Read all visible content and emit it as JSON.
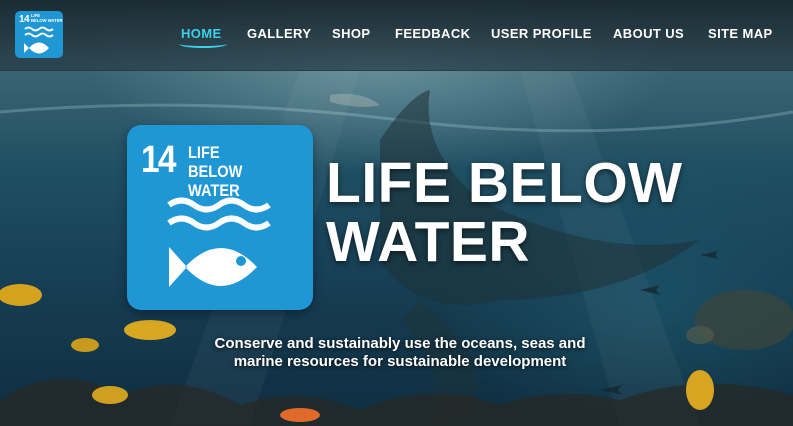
{
  "brand": {
    "logo_number": "14",
    "logo_text_line1": "LIFE",
    "logo_text_line2": "BELOW WATER",
    "color": "#1f97d4"
  },
  "nav": {
    "items": [
      {
        "label": "HOME",
        "active": true
      },
      {
        "label": "GALLERY",
        "active": false
      },
      {
        "label": "SHOP",
        "active": false
      },
      {
        "label": "FEEDBACK",
        "active": false
      },
      {
        "label": "USER PROFILE",
        "active": false
      },
      {
        "label": "ABOUT US",
        "active": false
      },
      {
        "label": "SITE MAP",
        "active": false
      }
    ],
    "active_color": "#39d0e8"
  },
  "hero": {
    "title": "LIFE BELOW WATER",
    "subtitle": "Conserve and sustainably use the oceans, seas and marine resources for sustainable development"
  },
  "icons": {
    "waves": "waves-icon",
    "fish": "fish-icon"
  }
}
